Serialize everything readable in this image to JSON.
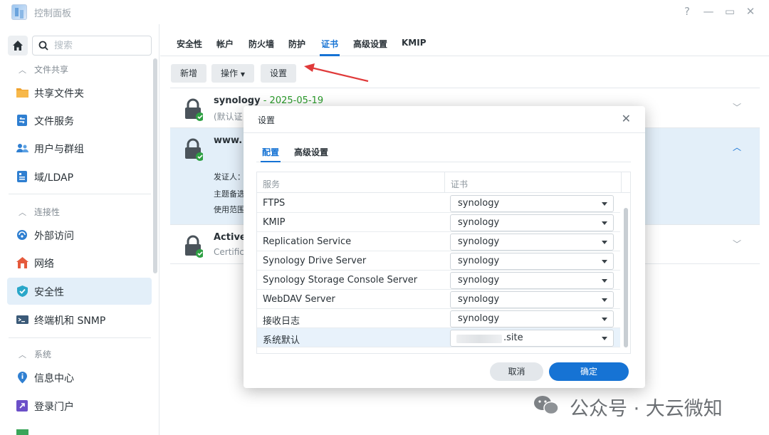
{
  "window": {
    "title": "控制面板"
  },
  "sidebar": {
    "search_placeholder": "搜索",
    "sections": [
      {
        "label": "文件共享"
      },
      {
        "label": "连接性"
      },
      {
        "label": "系统"
      }
    ],
    "items": [
      {
        "label": "共享文件夹",
        "icon": "shared-folder-icon"
      },
      {
        "label": "文件服务",
        "icon": "file-services-icon"
      },
      {
        "label": "用户与群组",
        "icon": "users-groups-icon"
      },
      {
        "label": "域/LDAP",
        "icon": "domain-ldap-icon"
      },
      {
        "label": "外部访问",
        "icon": "external-access-icon"
      },
      {
        "label": "网络",
        "icon": "network-icon"
      },
      {
        "label": "安全性",
        "icon": "security-shield-icon",
        "active": true
      },
      {
        "label": "终端机和 SNMP",
        "icon": "terminal-icon"
      },
      {
        "label": "信息中心",
        "icon": "info-center-icon"
      },
      {
        "label": "登录门户",
        "icon": "login-portal-icon"
      }
    ]
  },
  "main": {
    "tabs": [
      "安全性",
      "帐户",
      "防火墙",
      "防护",
      "证书",
      "高级设置",
      "KMIP"
    ],
    "active_tab": "证书",
    "toolbar": {
      "add": "新增",
      "action": "操作",
      "settings": "设置"
    },
    "certificates": [
      {
        "name": "synology",
        "separator": " - ",
        "date": "2025-05-19",
        "sub": "(默认证"
      },
      {
        "name": "www.",
        "details": [
          "发证人：",
          "主题备选",
          "使用范围"
        ]
      },
      {
        "name": "Active",
        "sub": "Certific"
      }
    ]
  },
  "dialog": {
    "title": "设置",
    "tabs": [
      "配置",
      "高级设置"
    ],
    "active_tab": "配置",
    "columns": {
      "service": "服务",
      "cert": "证书"
    },
    "rows": [
      {
        "service": "FTPS",
        "cert": "synology"
      },
      {
        "service": "KMIP",
        "cert": "synology"
      },
      {
        "service": "Replication Service",
        "cert": "synology"
      },
      {
        "service": "Synology Drive Server",
        "cert": "synology"
      },
      {
        "service": "Synology Storage Console Server",
        "cert": "synology"
      },
      {
        "service": "WebDAV Server",
        "cert": "synology"
      },
      {
        "service": "接收日志",
        "cert": "synology"
      },
      {
        "service": "系统默认",
        "cert": ".site"
      }
    ],
    "cancel": "取消",
    "ok": "确定"
  },
  "watermark": {
    "text": "公众号 · 大云微知"
  },
  "colors": {
    "accent": "#1673d4",
    "selection": "#e3eff9",
    "date_green": "#2a9a2a",
    "arrow_red": "#e03a3a"
  }
}
